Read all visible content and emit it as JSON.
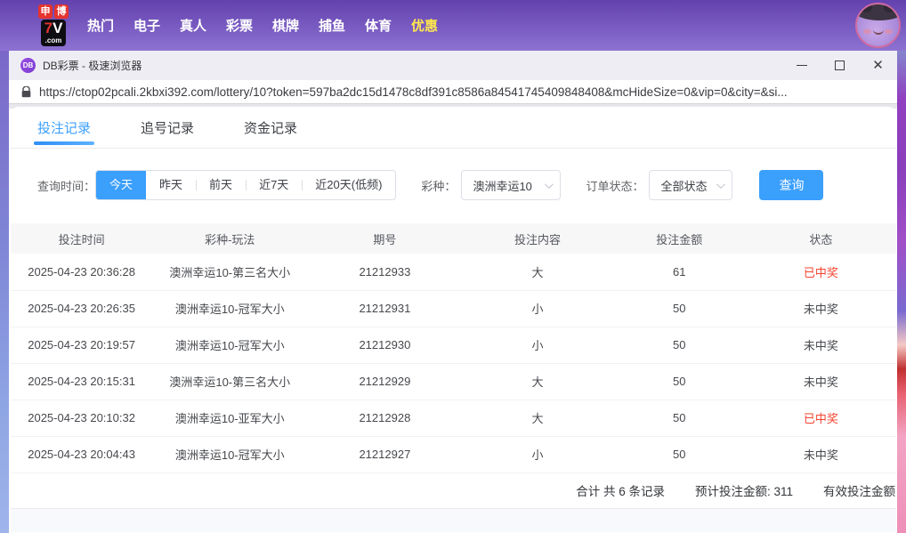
{
  "colors": {
    "accent_blue": "#3b9ffc",
    "win_red": "#f5432e",
    "nav_highlight_yellow": "#ffe84d",
    "nav_gradient_top": "#6341ae",
    "nav_gradient_bottom": "#8d72d2"
  },
  "site_nav": {
    "logo": {
      "cn1": "申",
      "cn2": "博",
      "mid_red": "7",
      "mid_white": "V",
      "com": ".com"
    },
    "items": [
      {
        "label": "热门"
      },
      {
        "label": "电子"
      },
      {
        "label": "真人"
      },
      {
        "label": "彩票"
      },
      {
        "label": "棋牌"
      },
      {
        "label": "捕鱼"
      },
      {
        "label": "体育"
      },
      {
        "label": "优惠",
        "highlight": true
      }
    ]
  },
  "browser": {
    "favicon_text": "DB",
    "title": "DB彩票 - 极速浏览器",
    "url": "https://ctop02pcali.2kbxi392.com/lottery/10?token=597ba2dc15d1478c8df391c8586a84541745409848408&mcHideSize=0&vip=0&city=&si...",
    "close_glyph": "✕"
  },
  "tabs": [
    {
      "label": "投注记录",
      "active": true
    },
    {
      "label": "追号记录"
    },
    {
      "label": "资金记录"
    }
  ],
  "filters": {
    "time_label": "查询时间：",
    "time_options": [
      {
        "label": "今天",
        "active": true
      },
      {
        "label": "昨天"
      },
      {
        "label": "前天"
      },
      {
        "label": "近7天"
      },
      {
        "label": "近20天(低频)"
      }
    ],
    "lottery_label": "彩种：",
    "lottery_value": "澳洲幸运10",
    "status_label": "订单状态：",
    "status_value": "全部状态",
    "query_button": "查询"
  },
  "table": {
    "columns": [
      "投注时间",
      "彩种-玩法",
      "期号",
      "投注内容",
      "投注金额",
      "状态"
    ],
    "rows": [
      {
        "time": "2025-04-23 20:36:28",
        "play": "澳洲幸运10-第三名大小",
        "issue": "21212933",
        "content": "大",
        "amount": "61",
        "status": "已中奖",
        "won": true
      },
      {
        "time": "2025-04-23 20:26:35",
        "play": "澳洲幸运10-冠军大小",
        "issue": "21212931",
        "content": "小",
        "amount": "50",
        "status": "未中奖"
      },
      {
        "time": "2025-04-23 20:19:57",
        "play": "澳洲幸运10-冠军大小",
        "issue": "21212930",
        "content": "小",
        "amount": "50",
        "status": "未中奖"
      },
      {
        "time": "2025-04-23 20:15:31",
        "play": "澳洲幸运10-第三名大小",
        "issue": "21212929",
        "content": "大",
        "amount": "50",
        "status": "未中奖"
      },
      {
        "time": "2025-04-23 20:10:32",
        "play": "澳洲幸运10-亚军大小",
        "issue": "21212928",
        "content": "大",
        "amount": "50",
        "status": "已中奖",
        "won": true
      },
      {
        "time": "2025-04-23 20:04:43",
        "play": "澳洲幸运10-冠军大小",
        "issue": "21212927",
        "content": "小",
        "amount": "50",
        "status": "未中奖"
      }
    ]
  },
  "summary": {
    "total_records": "合计 共 6 条记录",
    "expected_amount": "预计投注金额: 311",
    "valid_amount": "有效投注金额"
  }
}
